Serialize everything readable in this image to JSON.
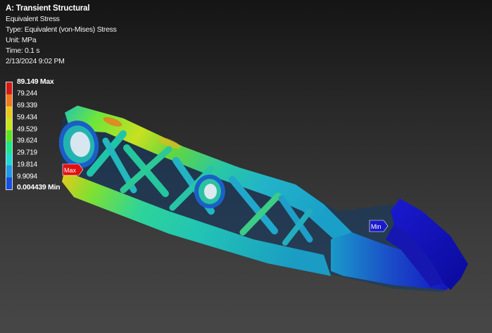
{
  "header": {
    "title": "A: Transient Structural",
    "result_name": "Equivalent Stress",
    "type_line": "Type: Equivalent (von-Mises) Stress",
    "unit_line": "Unit: MPa",
    "time_line": "Time: 0.1 s",
    "timestamp": "2/13/2024 9:02 PM"
  },
  "legend": {
    "max_label": "89.149 Max",
    "min_label": "0.004439 Min",
    "ticks": [
      "79.244",
      "69.339",
      "59.434",
      "49.529",
      "39.624",
      "29.719",
      "19.814",
      "9.9094"
    ],
    "colors": [
      "#d21a12",
      "#f0781e",
      "#ecc81a",
      "#c8e61a",
      "#5ae61e",
      "#1ee68c",
      "#1edcd2",
      "#1e9be6",
      "#1450dc"
    ]
  },
  "probes": {
    "max_label": "Max",
    "min_label": "Min",
    "max_color": "#e01010",
    "min_color": "#1a1acc"
  }
}
